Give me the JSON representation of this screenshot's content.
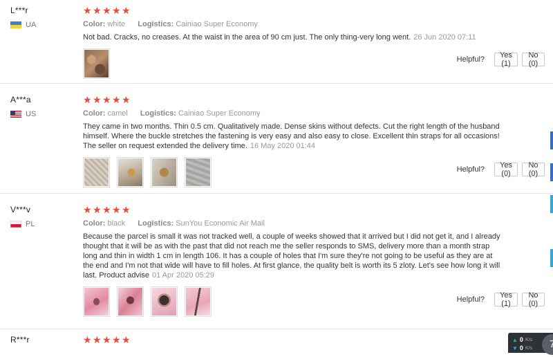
{
  "reviews": [
    {
      "username": "L***r",
      "country": "UA",
      "stars": 5,
      "color_label": "Color:",
      "color_value": "white",
      "logistics_label": "Logistics:",
      "logistics_value": "Cainiao Super Economy",
      "text": "Not bad. Cracks, no creases. At the waist in the area of 90 cm just. The only thing-very long went.",
      "date": "26 Jun 2020 07:11",
      "helpful_label": "Helpful?",
      "yes_label": "Yes (1)",
      "no_label": "No (0)"
    },
    {
      "username": "A***a",
      "country": "US",
      "stars": 5,
      "color_label": "Color:",
      "color_value": "camel",
      "logistics_label": "Logistics:",
      "logistics_value": "Cainiao Super Economy",
      "text": "They came in two months. Thin 0.5 cm. Qualitatively made. Dense skins without defects. Cut the right length of the husband himself. Where the buckle stretches the fastening is very easy and also easy to close. Excellent thin straps for all occasions! The seller on request extended the delivery time.",
      "date": "16 May 2020 01:44",
      "helpful_label": "Helpful?",
      "yes_label": "Yes (0)",
      "no_label": "No (0)"
    },
    {
      "username": "V***v",
      "country": "PL",
      "stars": 5,
      "color_label": "Color:",
      "color_value": "black",
      "logistics_label": "Logistics:",
      "logistics_value": "SunYou Economic Air Mail",
      "text": "Because the parcel is small it was not tracked well, a couple of weeks showed that it arrived but I did not get it, and I already thought that it will be as with the past that did not reach me the seller responds to SMS, delivery more than a month strap long and thin in width 1 cm in length 106. It has a couple of holes that I'm sure they're not going to be useful as they are at the end and I'm not that wide will have to fill holes. At first glance, the quality belt is worth its 5 zloty. Let's see how long it will last. Product advise",
      "date": "01 Apr 2020 05:29",
      "helpful_label": "Helpful?",
      "yes_label": "Yes (1)",
      "no_label": "No (0)"
    },
    {
      "username": "R***r",
      "stars": 5
    }
  ],
  "net_widget": {
    "up_value": "0",
    "up_unit": "K/s",
    "down_value": "0",
    "down_unit": "K/s",
    "badge": "7"
  },
  "colors": {
    "star": "#e74c3c",
    "divider": "#e8e8e8"
  }
}
